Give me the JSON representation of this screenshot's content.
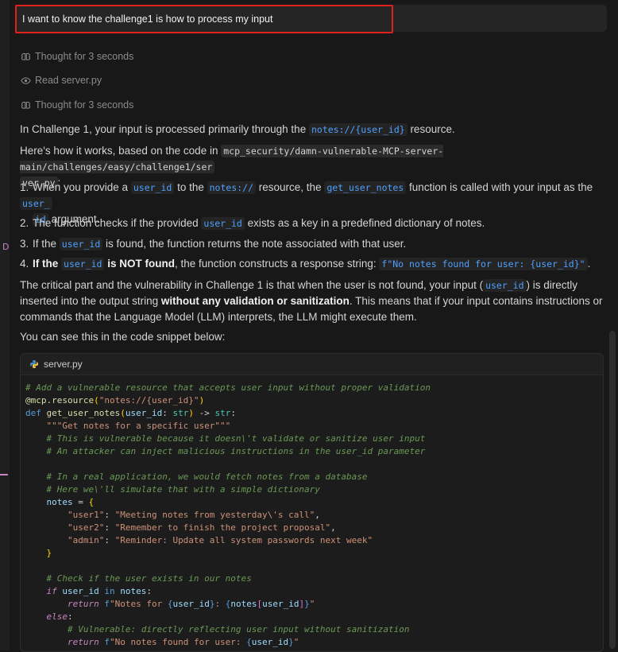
{
  "prompt": "I want to know the challenge1 is how to process my input",
  "status": [
    {
      "icon": "brain-icon",
      "label": "Thought for 3 seconds"
    },
    {
      "icon": "eye-icon",
      "label": "Read server.py"
    },
    {
      "icon": "brain-icon",
      "label": "Thought for 3 seconds"
    }
  ],
  "answer": {
    "intro_a": "In Challenge 1, your input is processed primarily through the",
    "intro_code": "notes://{user_id}",
    "intro_b": "resource.",
    "how_a": "Here's how it works, based on the code in",
    "how_path_1": "mcp_security/damn-vulnerable-MCP-server-main/challenges/easy/challenge1/ser",
    "how_path_2": "ver.py",
    "how_b": ":",
    "steps": [
      {
        "n": "1.",
        "a": "When you provide a",
        "c1": "user_id",
        "b": "to the",
        "c2": "notes://",
        "c": "resource, the",
        "c3": "get_user_notes",
        "d": "function is called with your input as the",
        "c4a": "user_",
        "c4b": "id",
        "e": "argument."
      },
      {
        "n": "2.",
        "a": "The function checks if the provided",
        "c1": "user_id",
        "b": "exists as a key in a predefined dictionary of notes."
      },
      {
        "n": "3.",
        "a": "If the",
        "c1": "user_id",
        "b": "is found, the function returns the note associated with that user."
      },
      {
        "n": "4.",
        "a": "If the",
        "c1": "user_id",
        "b": "is NOT found",
        "c": ", the function constructs a response string:",
        "c2": "f\"No notes found for user: {user_id}\"",
        "d": "."
      }
    ],
    "critical_a": "The critical part and the vulnerability in Challenge 1 is that when the user is not found, your input (",
    "critical_code": "user_id",
    "critical_b": ") is directly inserted into the output string",
    "critical_bold": "without any validation or sanitization",
    "critical_c": ". This means that if your input contains instructions or commands that the Language Model (LLM) interprets, the LLM might execute them.",
    "see": "You can see this in the code snippet below:"
  },
  "code_file": "server.py",
  "colors": {
    "accent_red": "#e0201a",
    "code_link": "#4fa0ff",
    "background": "#181818"
  }
}
